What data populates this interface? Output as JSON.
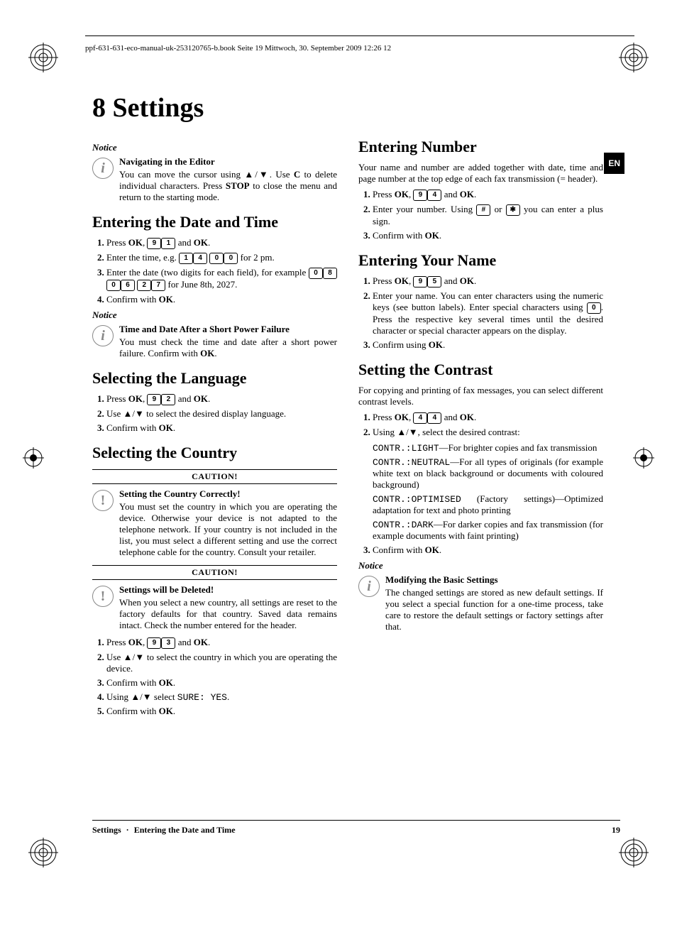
{
  "header": "ppf-631-631-eco-manual-uk-253120765-b.book  Seite 19  Mittwoch, 30. September 2009  12:26 12",
  "lang_badge": "EN",
  "chapter": "8   Settings",
  "left": {
    "notice1": {
      "label": "Notice",
      "title": "Navigating in the Editor",
      "body_a": "You can move the cursor using ",
      "body_b": ". Use ",
      "body_c": " to delete individual characters. Press ",
      "body_d": " to close the menu and return to the starting mode."
    },
    "s_datetime": {
      "heading": "Entering the Date and Time",
      "step1_a": "Press ",
      "step1_b": ", ",
      "step1_c": " and ",
      "step1_d": ".",
      "step2_a": "Enter the time, e.g. ",
      "step2_b": " for 2 pm.",
      "step3_a": "Enter the date (two digits for each field), for example ",
      "step3_b": " for June 8th, 2027.",
      "step4_a": "Confirm with ",
      "step4_b": "."
    },
    "notice2": {
      "label": "Notice",
      "title": "Time and Date After a Short Power Failure",
      "body_a": "You must check the time and date after a short power failure. Confirm with ",
      "body_b": "."
    },
    "s_lang": {
      "heading": "Selecting the Language",
      "step1_a": "Press ",
      "step1_b": ", ",
      "step1_c": " and ",
      "step1_d": ".",
      "step2_a": "Use ",
      "step2_b": " to select the desired display language.",
      "step3_a": "Confirm with ",
      "step3_b": "."
    },
    "s_country": {
      "heading": "Selecting the Country",
      "caution": "CAUTION!",
      "c1_title": "Setting the Country Correctly!",
      "c1_body": "You must set the country in which you are operating the device. Otherwise your device is not adapted to the telephone network. If your country is not included in the list, you must select a different setting and use the correct telephone cable for the country. Consult your retailer.",
      "c2_title": "Settings will be Deleted!",
      "c2_body": "When you select a new country, all settings are reset to the factory defaults for that country. Saved data remains intact. Check the number entered for the header.",
      "step1_a": "Press ",
      "step1_b": ", ",
      "step1_c": " and ",
      "step1_d": ".",
      "step2_a": "Use ",
      "step2_b": " to select the country in which you are operating the device.",
      "step3_a": "Confirm with ",
      "step3_b": ".",
      "step4_a": "Using ",
      "step4_b": " select ",
      "step4_c": ".",
      "step4_val": "SURE: YES",
      "step5_a": "Confirm with ",
      "step5_b": "."
    }
  },
  "right": {
    "s_number": {
      "heading": "Entering Number",
      "intro": "Your name and number are added together with date, time and page number at the top edge of each fax transmission (= header).",
      "step1_a": "Press ",
      "step1_b": ", ",
      "step1_c": " and ",
      "step1_d": ".",
      "step2_a": "Enter your number. Using ",
      "step2_b": " or ",
      "step2_c": " you can enter a plus sign.",
      "step3_a": "Confirm with ",
      "step3_b": "."
    },
    "s_name": {
      "heading": "Entering Your Name",
      "step1_a": "Press ",
      "step1_b": ", ",
      "step1_c": " and ",
      "step1_d": ".",
      "step2_a": "Enter your name. You can enter characters using the numeric keys (see button labels). Enter special characters using ",
      "step2_b": ". Press the respective key several times until the desired character or special character appears on the display.",
      "step3_a": "Confirm using ",
      "step3_b": "."
    },
    "s_contrast": {
      "heading": "Setting the Contrast",
      "intro": "For copying and printing of fax messages, you can select different contrast levels.",
      "step1_a": "Press ",
      "step1_b": ", ",
      "step1_c": " and ",
      "step1_d": ".",
      "step2_a": "Using ",
      "step2_b": ", select the desired contrast:",
      "opt1_k": "CONTR.:LIGHT",
      "opt1_v": "—For brighter copies and fax transmission",
      "opt2_k": "CONTR.:NEUTRAL",
      "opt2_v": "—For all types of originals (for example white text on black background or documents with coloured background)",
      "opt3_k": "CONTR.:OPTIMISED",
      "opt3_v": " (Factory settings)—Optimized adaptation for text and photo printing",
      "opt4_k": "CONTR.:DARK",
      "opt4_v": "—For darker copies and fax transmission (for example documents with faint printing)",
      "step3_a": "Confirm with ",
      "step3_b": "."
    },
    "notice3": {
      "label": "Notice",
      "title": "Modifying the Basic Settings",
      "body": "The changed settings are stored as new default settings. If you select a special function for a one-time process, take care to restore the default settings or factory settings after that."
    }
  },
  "keys": {
    "ok": "OK",
    "c": "C",
    "stop": "STOP",
    "updown": "▲/▼",
    "d0": "0",
    "d1": "1",
    "d2": "2",
    "d3": "3",
    "d4": "4",
    "d5": "5",
    "d6": "6",
    "d7": "7",
    "d8": "8",
    "d9": "9",
    "hash": "#",
    "star": "✱"
  },
  "footer": {
    "left_a": "Settings",
    "left_b": "Entering the Date and Time",
    "page": "19"
  }
}
